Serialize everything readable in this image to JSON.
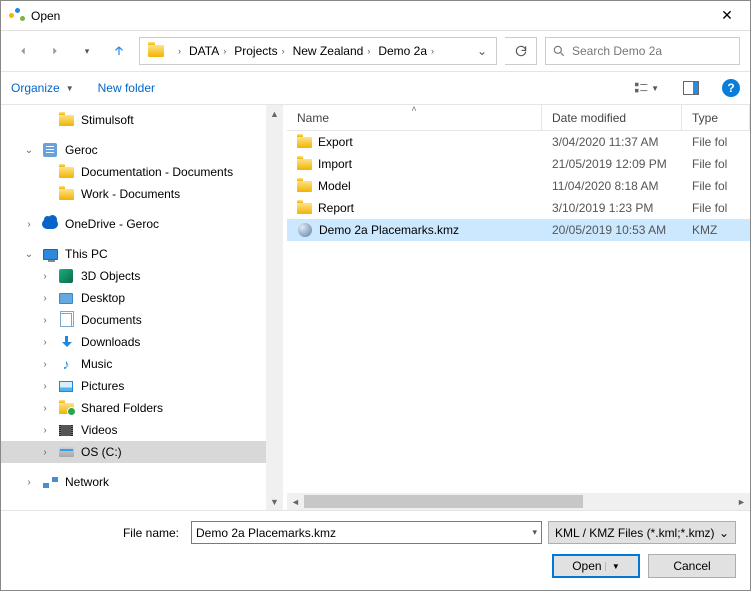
{
  "window": {
    "title": "Open"
  },
  "address": {
    "crumbs": [
      "DATA",
      "Projects",
      "New Zealand",
      "Demo 2a"
    ]
  },
  "search": {
    "placeholder": "Search Demo 2a"
  },
  "toolbar": {
    "organize": "Organize",
    "newfolder": "New folder"
  },
  "columns": {
    "name": "Name",
    "date": "Date modified",
    "type": "Type"
  },
  "tree": [
    {
      "indent": 2,
      "label": "Stimulsoft",
      "icon": "folder",
      "exp": ""
    },
    {
      "indent": 1,
      "label": "Geroc",
      "icon": "building",
      "exp": "v",
      "spaceBefore": true
    },
    {
      "indent": 2,
      "label": "Documentation - Documents",
      "icon": "folder",
      "exp": ""
    },
    {
      "indent": 2,
      "label": "Work - Documents",
      "icon": "folder",
      "exp": ""
    },
    {
      "indent": 1,
      "label": "OneDrive - Geroc",
      "icon": "cloud",
      "exp": ">",
      "spaceBefore": true
    },
    {
      "indent": 1,
      "label": "This PC",
      "icon": "monitor",
      "exp": "v",
      "spaceBefore": true
    },
    {
      "indent": 2,
      "label": "3D Objects",
      "icon": "3d",
      "exp": ">"
    },
    {
      "indent": 2,
      "label": "Desktop",
      "icon": "desktop",
      "exp": ">"
    },
    {
      "indent": 2,
      "label": "Documents",
      "icon": "docs",
      "exp": ">"
    },
    {
      "indent": 2,
      "label": "Downloads",
      "icon": "dl",
      "exp": ">"
    },
    {
      "indent": 2,
      "label": "Music",
      "icon": "music",
      "exp": ">"
    },
    {
      "indent": 2,
      "label": "Pictures",
      "icon": "pic",
      "exp": ">"
    },
    {
      "indent": 2,
      "label": "Shared Folders",
      "icon": "shared",
      "exp": ">"
    },
    {
      "indent": 2,
      "label": "Videos",
      "icon": "video",
      "exp": ">"
    },
    {
      "indent": 2,
      "label": "OS (C:)",
      "icon": "drive",
      "exp": ">",
      "selected": true
    },
    {
      "indent": 1,
      "label": "Network",
      "icon": "net",
      "exp": ">",
      "spaceBefore": true
    }
  ],
  "files": [
    {
      "name": "Export",
      "date": "3/04/2020 11:37 AM",
      "type": "File fol",
      "kind": "folder"
    },
    {
      "name": "Import",
      "date": "21/05/2019 12:09 PM",
      "type": "File fol",
      "kind": "folder"
    },
    {
      "name": "Model",
      "date": "11/04/2020 8:18 AM",
      "type": "File fol",
      "kind": "folder"
    },
    {
      "name": "Report",
      "date": "3/10/2019 1:23 PM",
      "type": "File fol",
      "kind": "folder"
    },
    {
      "name": "Demo 2a Placemarks.kmz",
      "date": "20/05/2019 10:53 AM",
      "type": "KMZ",
      "kind": "kmz",
      "selected": true
    }
  ],
  "footer": {
    "filename_label": "File name:",
    "filename_value": "Demo 2a Placemarks.kmz",
    "filetype": "KML / KMZ Files (*.kml;*.kmz)",
    "open": "Open",
    "cancel": "Cancel"
  }
}
